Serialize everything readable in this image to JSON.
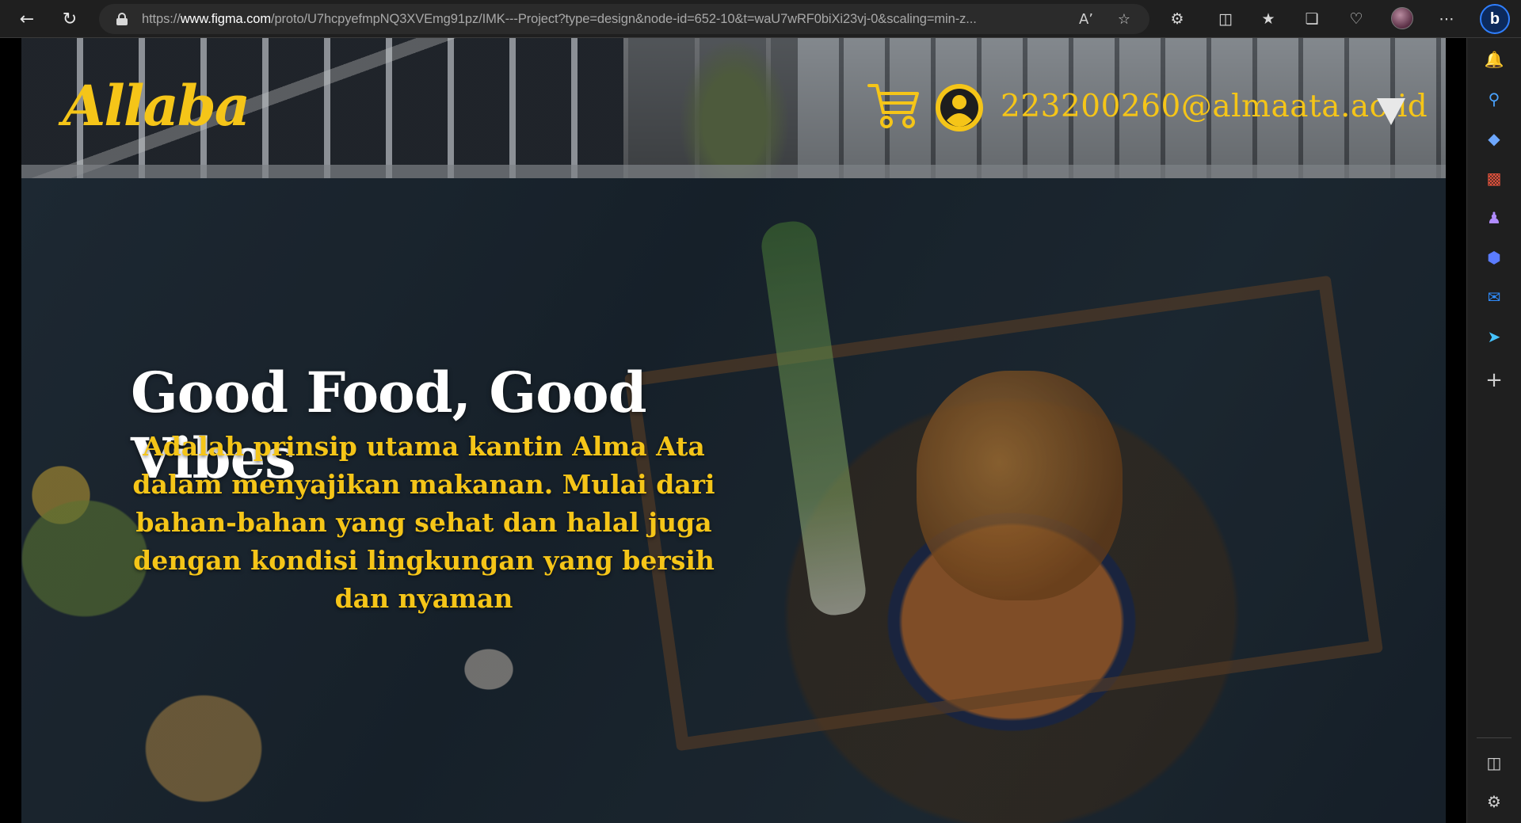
{
  "browser": {
    "url_prefix": "https://",
    "url_host": "www.figma.com",
    "url_path": "/proto/U7hcpyefmpNQ3XVEmg91pz/IMK---Project?type=design&node-id=652-10&t=waU7wRF0biXi23vj-0&scaling=min-z..."
  },
  "header": {
    "logo": "Allaba",
    "user_email": "223200260@almaata.ac.id"
  },
  "hero": {
    "headline": "Good Food, Good Vibes",
    "tagline": "Adalah prinsip utama kantin Alma Ata dalam menyajikan makanan. Mulai dari bahan-bahan yang sehat dan halal juga dengan kondisi lingkungan yang bersih dan nyaman"
  },
  "colors": {
    "accent": "#f5c518",
    "browser_bg": "#1f1f1f"
  },
  "icons": {
    "cart": "shopping-cart-icon",
    "user": "user-circle-icon",
    "dropdown": "dropdown-triangle-icon"
  }
}
